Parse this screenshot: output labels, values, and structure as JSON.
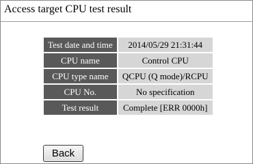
{
  "page": {
    "title": "Access target CPU test result"
  },
  "result_table": {
    "rows": [
      {
        "label": "Test date and time",
        "value": "2014/05/29 21:31:44"
      },
      {
        "label": "CPU name",
        "value": "Control CPU"
      },
      {
        "label": "CPU type name",
        "value": "QCPU (Q mode)/RCPU"
      },
      {
        "label": "CPU No.",
        "value": "No specification"
      },
      {
        "label": "Test result",
        "value": "Complete [ERR 0000h]"
      }
    ]
  },
  "actions": {
    "back_label": "Back"
  },
  "colors": {
    "label_bg": "#595959",
    "value_bg": "#d6d6d6"
  }
}
